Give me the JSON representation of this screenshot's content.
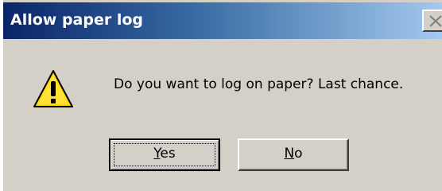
{
  "dialog": {
    "title": "Allow paper log",
    "message": "Do you want to log on paper? Last chance.",
    "icon": "warning-icon"
  },
  "buttons": {
    "yes": {
      "label_first": "Y",
      "label_rest": "es"
    },
    "no": {
      "label_first": "N",
      "label_rest": "o"
    }
  },
  "titlebar": {
    "close_icon": "close-icon",
    "gradient_start": "#0a246a",
    "gradient_end": "#a6caf0"
  },
  "colors": {
    "dialog_background": "#d4d0c8",
    "warning_yellow": "#ffd700"
  }
}
